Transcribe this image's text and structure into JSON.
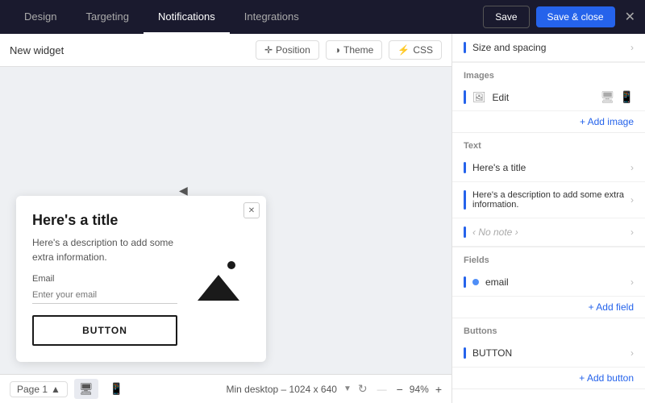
{
  "topnav": {
    "tabs": [
      {
        "label": "Design",
        "active": false
      },
      {
        "label": "Targeting",
        "active": false
      },
      {
        "label": "Notifications",
        "active": true
      },
      {
        "label": "Integrations",
        "active": false
      }
    ],
    "save_label": "Save",
    "save_close_label": "Save & close"
  },
  "toolbar": {
    "widget_title": "New widget",
    "position_label": "Position",
    "theme_label": "Theme",
    "css_label": "CSS"
  },
  "widget": {
    "title": "Here's a title",
    "description": "Here's a description to add some extra information.",
    "email_label": "Email",
    "email_placeholder": "Enter your email",
    "button_label": "BUTTON"
  },
  "bottom_bar": {
    "page_label": "Page 1",
    "resolution_label": "Min desktop – 1024 x 640",
    "zoom_value": "94%",
    "page_footer_label": "Page 1"
  },
  "right_panel": {
    "size_spacing_label": "Size and spacing",
    "images_section_title": "Images",
    "edit_label": "Edit",
    "add_image_label": "+ Add image",
    "text_section_title": "Text",
    "title_text": "Here's a title",
    "description_text": "Here's a description to add some extra information.",
    "no_note_label": "‹ No note ›",
    "fields_section_title": "Fields",
    "email_field_label": "email",
    "add_field_label": "+ Add field",
    "buttons_section_title": "Buttons",
    "button_label": "BUTTON",
    "add_button_label": "+ Add button"
  }
}
